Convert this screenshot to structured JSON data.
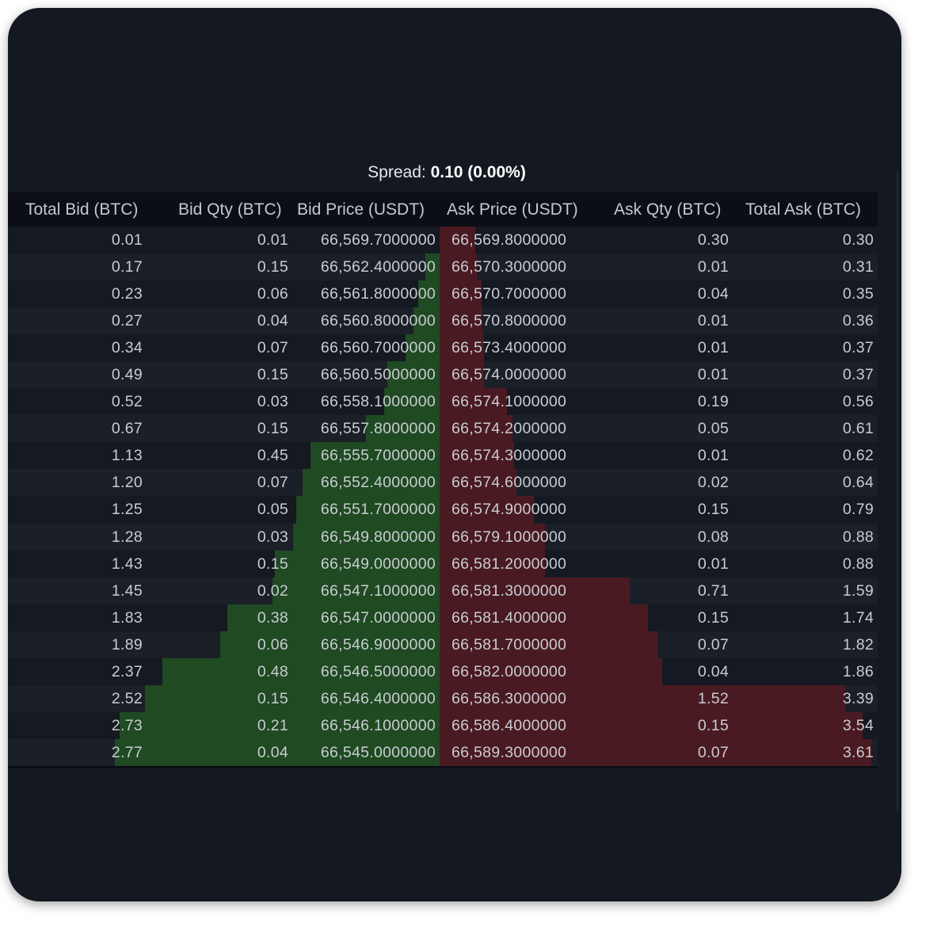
{
  "spread": {
    "label": "Spread:",
    "value": "0.10 (0.00%)"
  },
  "columns": {
    "total_bid": "Total Bid (BTC)",
    "bid_qty": "Bid Qty (BTC)",
    "bid_price": "Bid Price (USDT)",
    "ask_price": "Ask Price (USDT)",
    "ask_qty": "Ask Qty (BTC)",
    "total_ask": "Total Ask (BTC)"
  },
  "colors": {
    "bid_bar": "#1f4a22",
    "ask_bar": "#4a1a22",
    "background": "#141821"
  },
  "depth_max": 3.61,
  "rows": [
    {
      "total_bid": "0.01",
      "bid_qty": "0.01",
      "bid_price": "66,569.7000000",
      "ask_price": "66,569.8000000",
      "ask_qty": "0.30",
      "total_ask": "0.30"
    },
    {
      "total_bid": "0.17",
      "bid_qty": "0.15",
      "bid_price": "66,562.4000000",
      "ask_price": "66,570.3000000",
      "ask_qty": "0.01",
      "total_ask": "0.31"
    },
    {
      "total_bid": "0.23",
      "bid_qty": "0.06",
      "bid_price": "66,561.8000000",
      "ask_price": "66,570.7000000",
      "ask_qty": "0.04",
      "total_ask": "0.35"
    },
    {
      "total_bid": "0.27",
      "bid_qty": "0.04",
      "bid_price": "66,560.8000000",
      "ask_price": "66,570.8000000",
      "ask_qty": "0.01",
      "total_ask": "0.36"
    },
    {
      "total_bid": "0.34",
      "bid_qty": "0.07",
      "bid_price": "66,560.7000000",
      "ask_price": "66,573.4000000",
      "ask_qty": "0.01",
      "total_ask": "0.37"
    },
    {
      "total_bid": "0.49",
      "bid_qty": "0.15",
      "bid_price": "66,560.5000000",
      "ask_price": "66,574.0000000",
      "ask_qty": "0.01",
      "total_ask": "0.37"
    },
    {
      "total_bid": "0.52",
      "bid_qty": "0.03",
      "bid_price": "66,558.1000000",
      "ask_price": "66,574.1000000",
      "ask_qty": "0.19",
      "total_ask": "0.56"
    },
    {
      "total_bid": "0.67",
      "bid_qty": "0.15",
      "bid_price": "66,557.8000000",
      "ask_price": "66,574.2000000",
      "ask_qty": "0.05",
      "total_ask": "0.61"
    },
    {
      "total_bid": "1.13",
      "bid_qty": "0.45",
      "bid_price": "66,555.7000000",
      "ask_price": "66,574.3000000",
      "ask_qty": "0.01",
      "total_ask": "0.62"
    },
    {
      "total_bid": "1.20",
      "bid_qty": "0.07",
      "bid_price": "66,552.4000000",
      "ask_price": "66,574.6000000",
      "ask_qty": "0.02",
      "total_ask": "0.64"
    },
    {
      "total_bid": "1.25",
      "bid_qty": "0.05",
      "bid_price": "66,551.7000000",
      "ask_price": "66,574.9000000",
      "ask_qty": "0.15",
      "total_ask": "0.79"
    },
    {
      "total_bid": "1.28",
      "bid_qty": "0.03",
      "bid_price": "66,549.8000000",
      "ask_price": "66,579.1000000",
      "ask_qty": "0.08",
      "total_ask": "0.88"
    },
    {
      "total_bid": "1.43",
      "bid_qty": "0.15",
      "bid_price": "66,549.0000000",
      "ask_price": "66,581.2000000",
      "ask_qty": "0.01",
      "total_ask": "0.88"
    },
    {
      "total_bid": "1.45",
      "bid_qty": "0.02",
      "bid_price": "66,547.1000000",
      "ask_price": "66,581.3000000",
      "ask_qty": "0.71",
      "total_ask": "1.59"
    },
    {
      "total_bid": "1.83",
      "bid_qty": "0.38",
      "bid_price": "66,547.0000000",
      "ask_price": "66,581.4000000",
      "ask_qty": "0.15",
      "total_ask": "1.74"
    },
    {
      "total_bid": "1.89",
      "bid_qty": "0.06",
      "bid_price": "66,546.9000000",
      "ask_price": "66,581.7000000",
      "ask_qty": "0.07",
      "total_ask": "1.82"
    },
    {
      "total_bid": "2.37",
      "bid_qty": "0.48",
      "bid_price": "66,546.5000000",
      "ask_price": "66,582.0000000",
      "ask_qty": "0.04",
      "total_ask": "1.86"
    },
    {
      "total_bid": "2.52",
      "bid_qty": "0.15",
      "bid_price": "66,546.4000000",
      "ask_price": "66,586.3000000",
      "ask_qty": "1.52",
      "total_ask": "3.39"
    },
    {
      "total_bid": "2.73",
      "bid_qty": "0.21",
      "bid_price": "66,546.1000000",
      "ask_price": "66,586.4000000",
      "ask_qty": "0.15",
      "total_ask": "3.54"
    },
    {
      "total_bid": "2.77",
      "bid_qty": "0.04",
      "bid_price": "66,545.0000000",
      "ask_price": "66,589.3000000",
      "ask_qty": "0.07",
      "total_ask": "3.61"
    }
  ]
}
